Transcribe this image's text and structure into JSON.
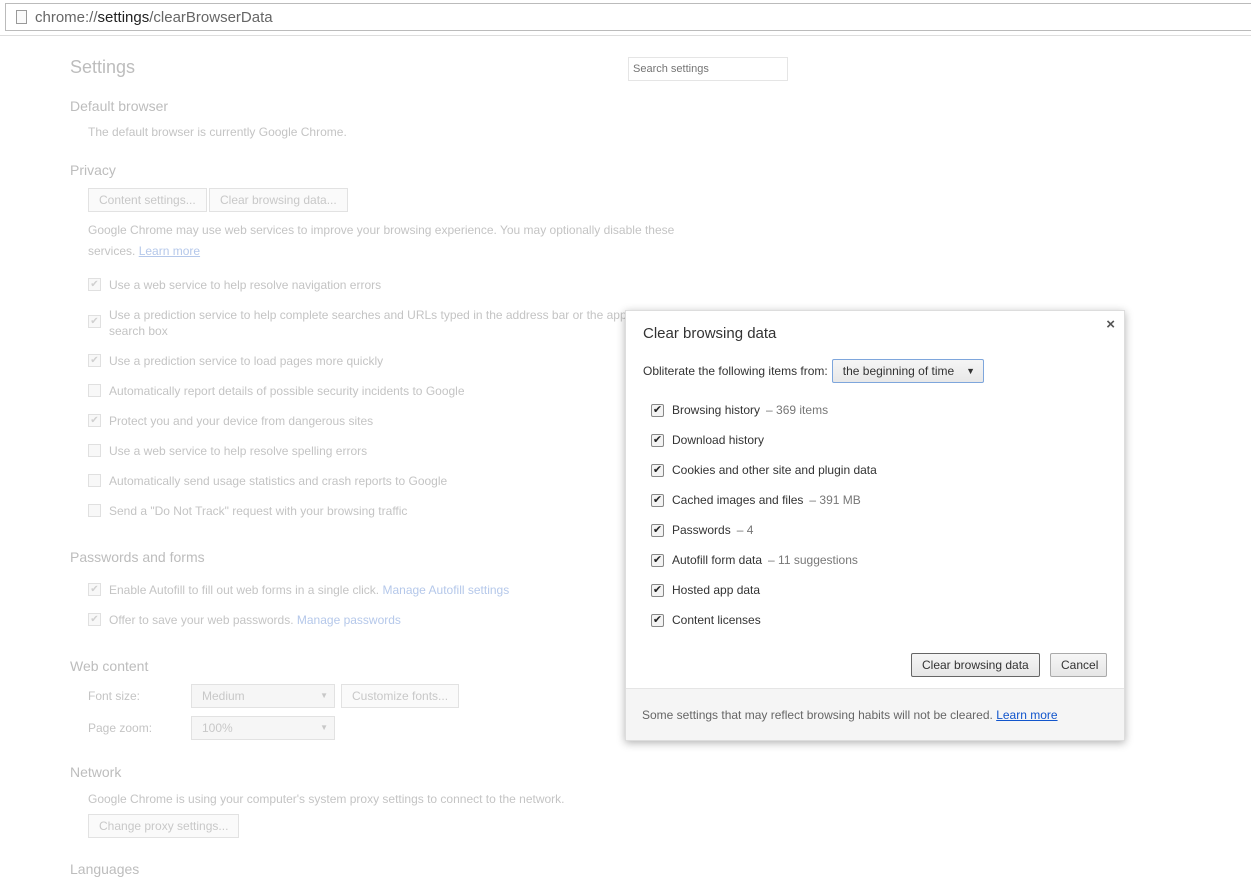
{
  "address_bar": {
    "prefix": "chrome://",
    "host": "settings",
    "path": "/clearBrowserData"
  },
  "settings": {
    "title": "Settings",
    "search_placeholder": "Search settings",
    "default_browser": {
      "heading": "Default browser",
      "text": "The default browser is currently Google Chrome."
    },
    "privacy": {
      "heading": "Privacy",
      "content_settings": "Content settings...",
      "clear_data": "Clear browsing data...",
      "desc_1": "Google Chrome may use web services to improve your browsing experience. You may optionally disable these",
      "desc_2": "services.",
      "learn_more": "Learn more",
      "options": [
        {
          "label": "Use a web service to help resolve navigation errors",
          "checked": true
        },
        {
          "label": "Use a prediction service to help complete searches and URLs typed in the address bar or the app launcher",
          "label2": "search box",
          "checked": true
        },
        {
          "label": "Use a prediction service to load pages more quickly",
          "checked": true
        },
        {
          "label": "Automatically report details of possible security incidents to Google",
          "checked": false
        },
        {
          "label": "Protect you and your device from dangerous sites",
          "checked": true
        },
        {
          "label": "Use a web service to help resolve spelling errors",
          "checked": false
        },
        {
          "label": "Automatically send usage statistics and crash reports to Google",
          "checked": false
        },
        {
          "label": "Send a \"Do Not Track\" request with your browsing traffic",
          "checked": false
        }
      ]
    },
    "passwords": {
      "heading": "Passwords and forms",
      "autofill": "Enable Autofill to fill out web forms in a single click.",
      "autofill_link": "Manage Autofill settings",
      "save": "Offer to save your web passwords.",
      "save_link": "Manage passwords"
    },
    "web_content": {
      "heading": "Web content",
      "font_size_label": "Font size:",
      "font_size": "Medium",
      "customize": "Customize fonts...",
      "zoom_label": "Page zoom:",
      "zoom": "100%"
    },
    "network": {
      "heading": "Network",
      "text": "Google Chrome is using your computer's system proxy settings to connect to the network.",
      "proxy": "Change proxy settings..."
    },
    "languages": {
      "heading": "Languages"
    }
  },
  "dialog": {
    "title": "Clear browsing data",
    "close": "×",
    "from_label": "Obliterate the following items from:",
    "from_value": "the beginning of time",
    "items": [
      {
        "label": "Browsing history",
        "extra": "–  369 items"
      },
      {
        "label": "Download history",
        "extra": ""
      },
      {
        "label": "Cookies and other site and plugin data",
        "extra": ""
      },
      {
        "label": "Cached images and files",
        "extra": "–  391 MB"
      },
      {
        "label": "Passwords",
        "extra": "–  4"
      },
      {
        "label": "Autofill form data",
        "extra": "–  11 suggestions"
      },
      {
        "label": "Hosted app data",
        "extra": ""
      },
      {
        "label": "Content licenses",
        "extra": ""
      }
    ],
    "clear_button": "Clear browsing data",
    "cancel_button": "Cancel",
    "footer_text": "Some settings that may reflect browsing habits will not be cleared.",
    "footer_link": "Learn more"
  }
}
